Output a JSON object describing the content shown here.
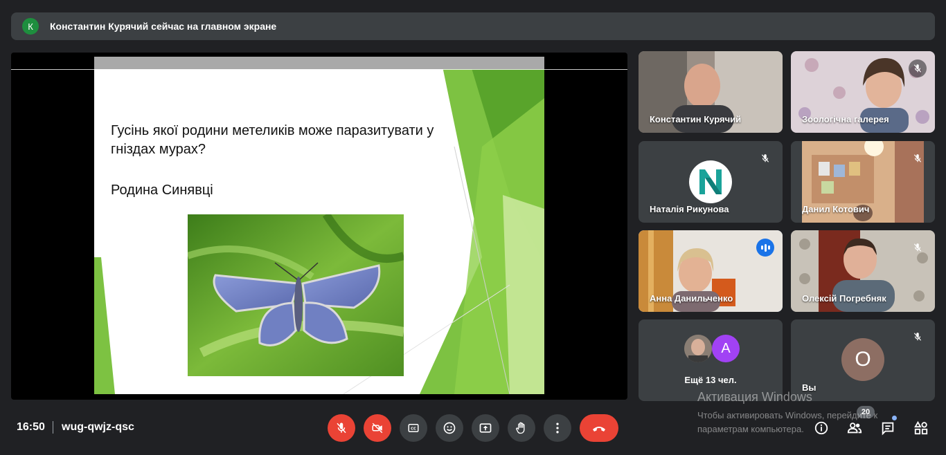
{
  "banner": {
    "avatar_letter": "К",
    "text": "Константин Курячий сейчас на главном экране"
  },
  "slide": {
    "question": "Гусінь якої родини метеликів може паразитувати у гніздах мурах?",
    "answer": "Родина Синявці"
  },
  "participants": [
    {
      "name": "Константин Курячий",
      "muted": false
    },
    {
      "name": "Зоологічна галерея",
      "muted": true
    },
    {
      "name": "Наталія Рикунова",
      "muted": true,
      "logo_letter": "N"
    },
    {
      "name": "Данил Котович",
      "muted": true
    },
    {
      "name": "Анна Данильченко",
      "speaking": true
    },
    {
      "name": "Олексій Погребняк",
      "muted": true
    }
  ],
  "more": {
    "avatar_letter": "A",
    "label": "Ещё 13 чел."
  },
  "self": {
    "avatar_letter": "О",
    "name": "Вы",
    "muted": true
  },
  "bottom": {
    "time": "16:50",
    "meeting_code": "wug-qwjz-qsc",
    "participants_count": "20"
  },
  "watermark": {
    "title": "Активация Windows",
    "line1": "Чтобы активировать Windows, перейдите к",
    "line2": "параметрам компьютера."
  },
  "colors": {
    "background": "#202124",
    "tile": "#3c4043",
    "danger": "#ea4335",
    "accent_blue": "#1a73e8",
    "speaking_outline": "#8ab4f8",
    "slide_green": "#7dc242"
  }
}
